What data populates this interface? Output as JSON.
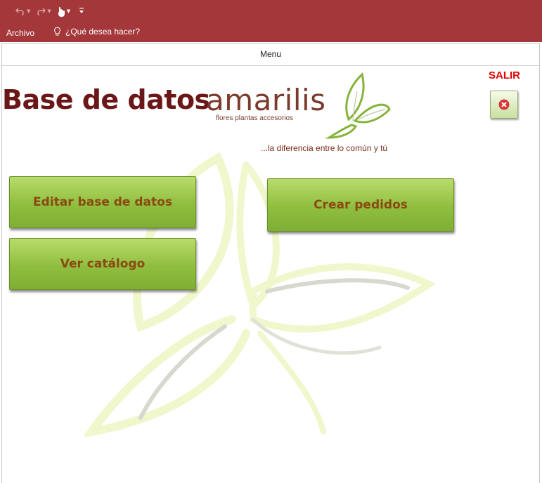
{
  "quick_access": {
    "undo_icon": "undo-icon",
    "redo_icon": "redo-icon",
    "touch_icon": "touch-mode-icon",
    "customize_icon": "customize-toolbar-icon"
  },
  "ribbon": {
    "file_tab": "Archivo",
    "tell_me_placeholder": "¿Qué desea hacer?",
    "tell_me_icon": "lightbulb-icon"
  },
  "form": {
    "caption": "Menu",
    "title": "Base de datos",
    "logo": {
      "word": "amarilis",
      "subtitle": "flores   plantas   accesorios",
      "tagline": "...la diferencia entre lo común y tú"
    },
    "exit": {
      "label": "SALIR",
      "icon": "close-circle-icon"
    },
    "buttons": {
      "edit_db": "Editar base de datos",
      "create_orders": "Crear pedidos",
      "view_catalog": "Ver catálogo"
    }
  },
  "colors": {
    "ribbon": "#a4373a",
    "title": "#6b1717",
    "exit_label": "#e00000",
    "button_green": "#8fbe3f",
    "button_text": "#8a4a12"
  }
}
